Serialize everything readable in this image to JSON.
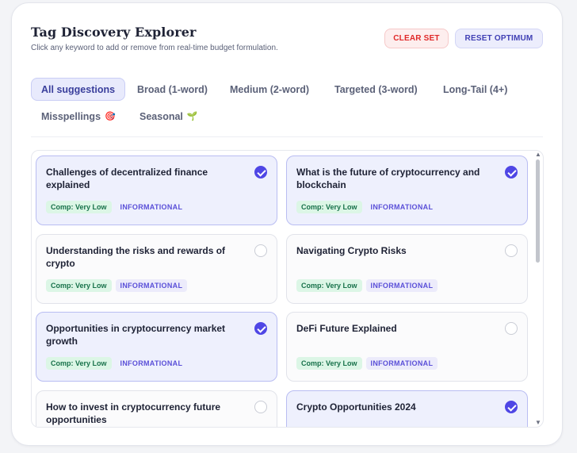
{
  "header": {
    "title": "Tag Discovery Explorer",
    "subtitle": "Click any keyword to add or remove from real-time budget formulation."
  },
  "actions": {
    "clear_label": "CLEAR SET",
    "reset_label": "RESET OPTIMUM"
  },
  "tabs": [
    {
      "label": "All suggestions",
      "emoji": "",
      "active": true
    },
    {
      "label": "Broad (1-word)",
      "emoji": "",
      "active": false
    },
    {
      "label": "Medium (2-word)",
      "emoji": "",
      "active": false
    },
    {
      "label": "Targeted (3-word)",
      "emoji": "",
      "active": false
    },
    {
      "label": "Long-Tail (4+)",
      "emoji": "",
      "active": false
    },
    {
      "label": "Misspellings",
      "emoji": "🎯",
      "active": false
    },
    {
      "label": "Seasonal",
      "emoji": "🌱",
      "active": false
    }
  ],
  "keywords": [
    {
      "title": "Challenges of decentralized finance explained",
      "competition": "Comp: Very Low",
      "intent": "INFORMATIONAL",
      "selected": true
    },
    {
      "title": "What is the future of cryptocurrency and blockchain",
      "competition": "Comp: Very Low",
      "intent": "INFORMATIONAL",
      "selected": true
    },
    {
      "title": "Understanding the risks and rewards of crypto",
      "competition": "Comp: Very Low",
      "intent": "INFORMATIONAL",
      "selected": false
    },
    {
      "title": "Navigating Crypto Risks",
      "competition": "Comp: Very Low",
      "intent": "INFORMATIONAL",
      "selected": false
    },
    {
      "title": "Opportunities in cryptocurrency market growth",
      "competition": "Comp: Very Low",
      "intent": "INFORMATIONAL",
      "selected": true
    },
    {
      "title": "DeFi Future Explained",
      "competition": "Comp: Very Low",
      "intent": "INFORMATIONAL",
      "selected": false
    },
    {
      "title": "How to invest in cryptocurrency future opportunities",
      "competition": "",
      "intent": "",
      "selected": false
    },
    {
      "title": "Crypto Opportunities 2024",
      "competition": "",
      "intent": "",
      "selected": true
    }
  ],
  "colors": {
    "accent": "#4f46e5",
    "clear": "#e02828",
    "competition_bg": "#dcf6e6",
    "competition_text": "#17714a"
  }
}
